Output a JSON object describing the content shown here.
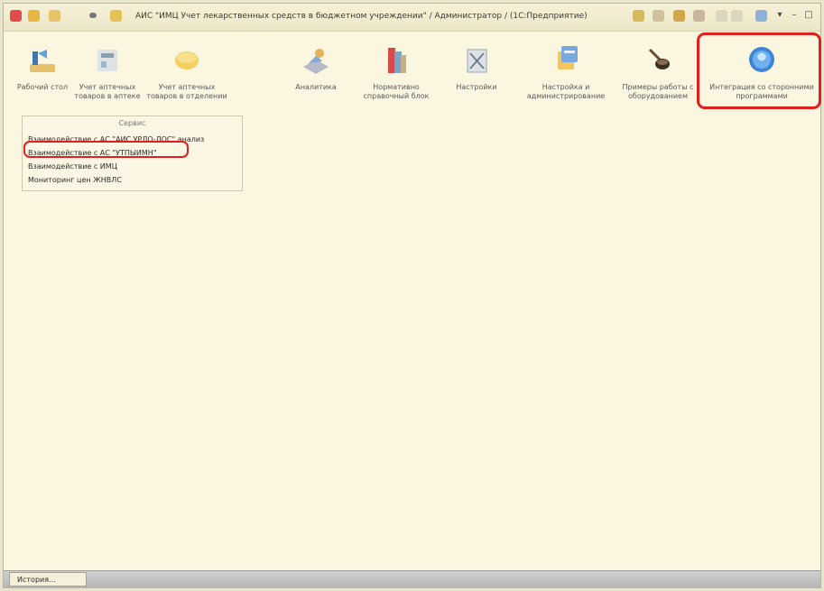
{
  "window": {
    "title": "АИС \"ИМЦ Учет лекарственных средств в бюджетном учреждении\" / Администратор / (1С:Предприятие)"
  },
  "toolbar": {
    "items": [
      {
        "label": "Рабочий стол",
        "icon": "desktop-icon"
      },
      {
        "label": "Учет аптечных товаров в аптеке",
        "icon": "pharmacy-icon"
      },
      {
        "label": "Учет аптечных товаров в отделении",
        "icon": "pill-icon"
      },
      {
        "label": "Аналитика",
        "icon": "analytics-icon"
      },
      {
        "label": "Нормативно справочный блок",
        "icon": "books-icon"
      },
      {
        "label": "Настройки",
        "icon": "settings-icon"
      },
      {
        "label": "Настройка и администрирование",
        "icon": "admin-icon"
      },
      {
        "label": "Примеры работы с оборудованием",
        "icon": "equipment-icon"
      },
      {
        "label": "Интеграция со сторонними программами",
        "icon": "globe-icon"
      }
    ]
  },
  "submenu": {
    "title": "Сервис",
    "items": [
      "Взаимодействие с АС \"АИС УРЛО-ЛОС\" анализ",
      "Взаимодействие с АС \"УТПЫИМН\"",
      "Взаимодействие с ИМЦ",
      "Мониторинг цен ЖНВЛС"
    ]
  },
  "bottom": {
    "history_tab": "История..."
  },
  "colors": {
    "highlight": "#e21f1f",
    "background": "#fbf6e0"
  }
}
